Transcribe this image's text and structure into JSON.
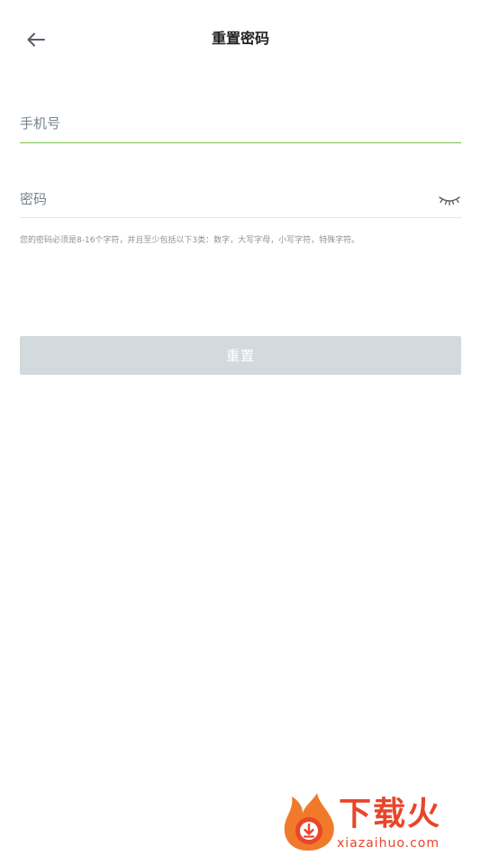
{
  "header": {
    "title": "重置密码",
    "back_icon": "arrow-left-icon"
  },
  "form": {
    "phone_placeholder": "手机号",
    "phone_value": "",
    "password_placeholder": "密码",
    "password_value": "",
    "password_toggle_icon": "eye-closed-icon",
    "password_hint": "您的密码必须是8-16个字符，并且至少包括以下3类：数字，大写字母，小写字符，特殊字符。",
    "active_underline_color": "#79c24a"
  },
  "actions": {
    "reset_label": "重置",
    "reset_color": "#d3dade"
  },
  "watermark": {
    "brand": "下载火",
    "url": "xiazaihuo.com",
    "color": "#e8452b"
  }
}
